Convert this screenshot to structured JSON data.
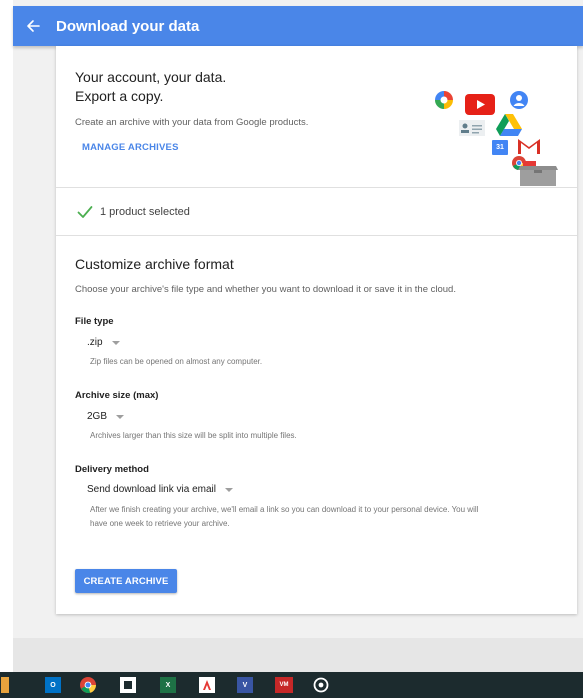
{
  "appbar": {
    "title": "Download your data",
    "back_icon": "arrow-left-icon"
  },
  "hero": {
    "title_line1": "Your account, your data.",
    "title_line2": "Export a copy.",
    "subtitle": "Create an archive with your data from Google products.",
    "manage_link": "MANAGE ARCHIVES",
    "icons": [
      "photos-icon",
      "youtube-icon",
      "contacts-icon",
      "drive-icon",
      "calendar-icon",
      "gmail-icon",
      "chrome-icon",
      "archive-box-icon"
    ],
    "calendar_label": "31"
  },
  "selection": {
    "text": "1 product selected",
    "icon": "check-icon"
  },
  "format": {
    "title": "Customize archive format",
    "description": "Choose your archive's file type and whether you want to download it or save it in the cloud.",
    "file_type": {
      "label": "File type",
      "value": ".zip",
      "hint": "Zip files can be opened on almost any computer."
    },
    "archive_size": {
      "label": "Archive size (max)",
      "value": "2GB",
      "hint": "Archives larger than this size will be split into multiple files."
    },
    "delivery": {
      "label": "Delivery method",
      "value": "Send download link via email",
      "hint_line1": "After we finish creating your archive, we'll email a link so you can download it to your personal device. You will",
      "hint_line2": "have one week to retrieve your archive."
    },
    "create_button": "CREATE ARCHIVE"
  },
  "taskbar": {
    "apps": [
      {
        "icon": "outlook-icon",
        "label": "O"
      },
      {
        "icon": "chrome-icon",
        "label": ""
      },
      {
        "icon": "project-icon",
        "label": ""
      },
      {
        "icon": "excel-icon",
        "label": "X"
      },
      {
        "icon": "acrobat-icon",
        "label": ""
      },
      {
        "icon": "visio-icon",
        "label": "V"
      },
      {
        "icon": "vmware-icon",
        "label": "VM"
      },
      {
        "icon": "target-app-icon",
        "label": ""
      }
    ]
  },
  "colors": {
    "accent": "#4a86e8",
    "check": "#4caf50",
    "taskbar": "#1c2b2e"
  }
}
